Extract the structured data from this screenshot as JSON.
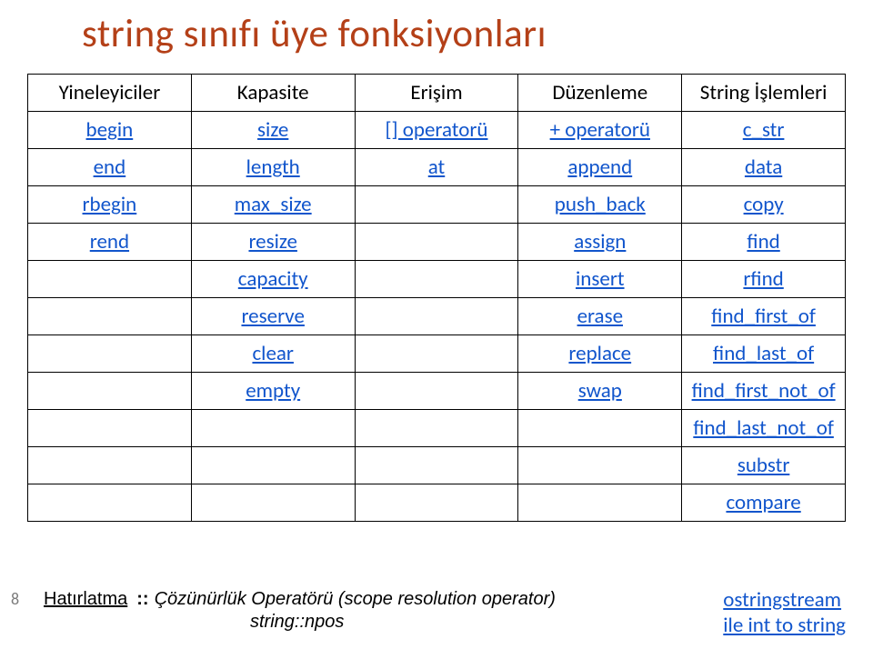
{
  "title": "string sınıfı üye fonksiyonları",
  "headers": {
    "c0": "Yineleyiciler",
    "c1": "Kapasite",
    "c2": "Erişim",
    "c3": "Düzenleme",
    "c4": "String İşlemleri"
  },
  "rows": [
    {
      "c0": "begin",
      "c1": "size",
      "c2": "[] operatorü",
      "c3": "+ operatorü",
      "c4": "c_str"
    },
    {
      "c0": "end",
      "c1": "length",
      "c2": "at",
      "c3": "append",
      "c4": "data"
    },
    {
      "c0": "rbegin",
      "c1": "max_size",
      "c2": "",
      "c3": "push_back",
      "c4": "copy"
    },
    {
      "c0": "rend",
      "c1": "resize",
      "c2": "",
      "c3": "assign",
      "c4": "find"
    },
    {
      "c0": "",
      "c1": "capacity",
      "c2": "",
      "c3": "insert",
      "c4": "rfind"
    },
    {
      "c0": "",
      "c1": "reserve",
      "c2": "",
      "c3": "erase",
      "c4": "find_first_of"
    },
    {
      "c0": "",
      "c1": "clear",
      "c2": "",
      "c3": "replace",
      "c4": "find_last_of"
    },
    {
      "c0": "",
      "c1": "empty",
      "c2": "",
      "c3": "swap",
      "c4": "find_first_not_of"
    },
    {
      "c0": "",
      "c1": "",
      "c2": "",
      "c3": "",
      "c4": "find_last_not_of"
    },
    {
      "c0": "",
      "c1": "",
      "c2": "",
      "c3": "",
      "c4": "substr"
    },
    {
      "c0": "",
      "c1": "",
      "c2": "",
      "c3": "",
      "c4": "compare"
    }
  ],
  "footer": {
    "page": "8",
    "hatirla": "Hatırlatma",
    "cc": "::",
    "rest1": "Çözünürlük Operatörü (scope resolution operator)",
    "line2": "string::npos",
    "right1": "ostringstream",
    "right2": "ile int to string"
  }
}
